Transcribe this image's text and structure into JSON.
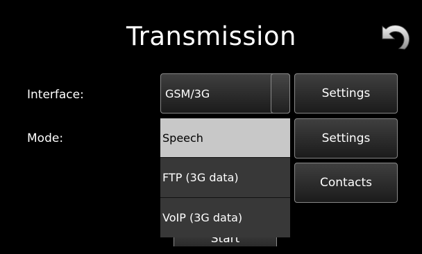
{
  "header": {
    "title": "Transmission",
    "back_icon": "undo-arrow-icon"
  },
  "interface": {
    "label": "Interface:",
    "value": "GSM/3G",
    "settings_label": "Settings"
  },
  "mode": {
    "label": "Mode:",
    "settings_label": "Settings",
    "options": [
      "Speech",
      "FTP (3G data)",
      "VoIP (3G data)"
    ],
    "selected": "Speech"
  },
  "contacts": {
    "label": "Contacts"
  },
  "start": {
    "label": "Start"
  }
}
